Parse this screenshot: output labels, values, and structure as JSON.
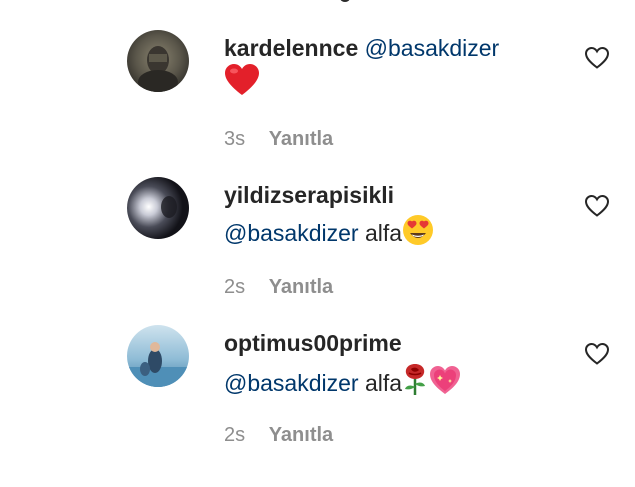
{
  "comments": [
    {
      "username": "kardelennce",
      "mention": "@basakdizer",
      "text": "",
      "emojis": [
        "red-heart"
      ],
      "time": "3s",
      "reply_label": "Yanıtla"
    },
    {
      "username": "yildizserapisikli",
      "mention": "@basakdizer",
      "text": "alfa",
      "emojis": [
        "heart-eyes-face"
      ],
      "time": "2s",
      "reply_label": "Yanıtla"
    },
    {
      "username": "optimus00prime",
      "mention": "@basakdizer",
      "text": "alfa",
      "emojis": [
        "rose",
        "sparkling-heart"
      ],
      "time": "2s",
      "reply_label": "Yanıtla"
    }
  ],
  "icons": {
    "like": "heart-outline-icon"
  },
  "colors": {
    "username": "#262626",
    "mention": "#00376b",
    "meta": "#8e8e8e"
  }
}
